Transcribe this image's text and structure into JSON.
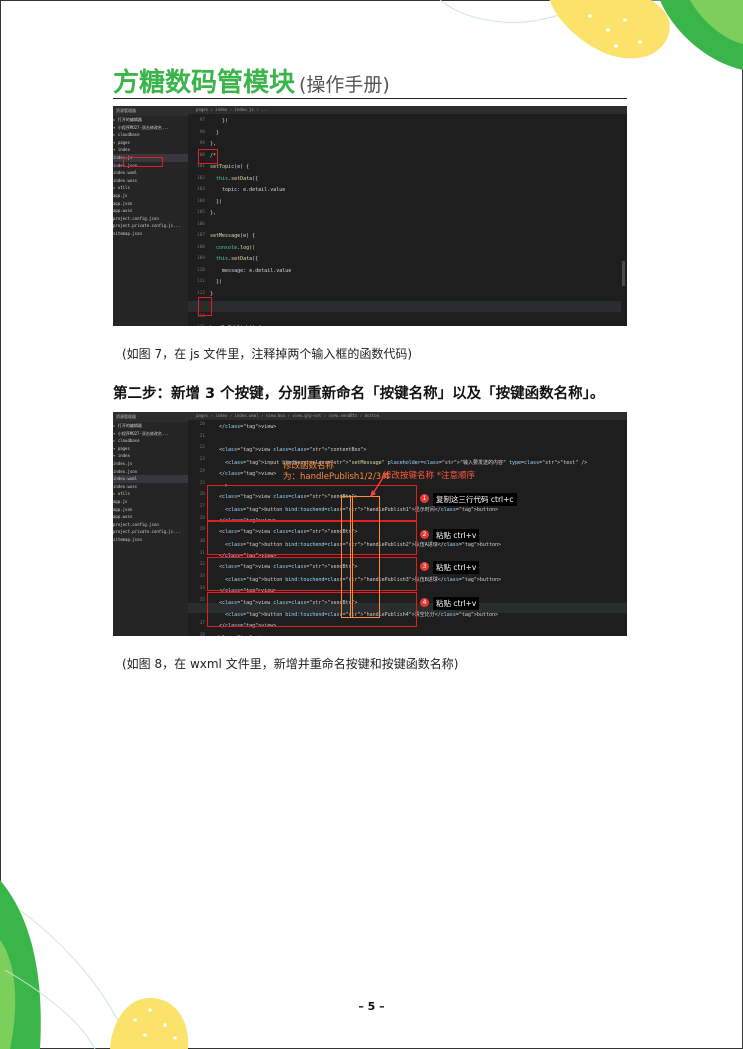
{
  "header": {
    "title": "方糖数码管模块",
    "subtitle": "(操作手册)"
  },
  "fig7": {
    "sidebar_title": "资源管理器",
    "sidebar_rows": [
      "▸ 打开的编辑器",
      "▾ 小程序MO27-双击修改名...",
      "  ▸ cloudbase",
      "  ▾ pages",
      "    ▾ index",
      "      index.js",
      "      index.json",
      "      index.wxml",
      "      index.wxss",
      "  ▸ utils",
      "    app.js",
      "    app.json",
      "    app.wxss",
      "    project.config.json",
      "    project.private.config.js...",
      "    sitemap.json"
    ],
    "tabs": "pages › index › index.js › ...",
    "line_numbers": [
      "97",
      "98",
      "99",
      "100",
      "101",
      "102",
      "103",
      "104",
      "105",
      "106",
      "107",
      "108",
      "109",
      "110",
      "111",
      "112",
      "113",
      "114",
      "115"
    ],
    "code": [
      "    })",
      "  }",
      "},",
      "/*",
      "setTopic(e) {",
      "  this.setData({",
      "    topic: e.detail.value",
      "  })",
      "},",
      "",
      "setMessage(e) {",
      "  console.log()",
      "  this.setData({",
      "    message: e.detail.value",
      "  })",
      "}",
      "*/",
      "",
      "handlePublish() {"
    ],
    "caption": "(如图 7，在 js 文件里，注释掉两个输入框的函数代码)"
  },
  "step2": "第二步：新增 3 个按键，分别重新命名「按键名称」以及「按键函数名称」。",
  "fig8": {
    "sidebar_title": "资源管理器",
    "sidebar_rows": [
      "▸ 打开的编辑器",
      "▾ 小程序MO27-双击修改名...",
      "  ▸ cloudbase",
      "  ▾ pages",
      "    ▾ index",
      "      index.js",
      "      index.json",
      "      index.wxml",
      "      index.wxss",
      "  ▸ utils",
      "    app.js",
      "    app.json",
      "    app.wxss",
      "    project.config.json",
      "    project.private.config.js...",
      "    sitemap.json"
    ],
    "tabs": "pages › index › index.wxml › view.box › view.grp-set › view.sendBtn › button",
    "line_numbers": [
      "20",
      "21",
      "22",
      "23",
      "24",
      "25",
      "26",
      "27",
      "28",
      "29",
      "30",
      "31",
      "32",
      "33",
      "34",
      "35",
      "36",
      "37",
      "38",
      "39"
    ],
    "code": [
      "  </view>",
      "",
      "  <view class=\"contentBox\">",
      "    <input bindinput=\"setMessage\" placeholder=\"输入要发送的内容\" type=\"text\" />",
      "  </view>",
      "  -->",
      "  <view class=\"sendBtn\">",
      "    <button bind:touchend=\"handlePublish1\">显示时间</button>",
      "  </view>",
      "  <view class=\"sendBtn\">",
      "    <button bind:touchend=\"handlePublish2\">队伍A进球</button>",
      "  </view>",
      "  <view class=\"sendBtn\">",
      "    <button bind:touchend=\"handlePublish3\">队伍B进球</button>",
      "  </view>",
      "  <view class=\"sendBtn\">",
      "    <button bind:touchend=\"handlePublish4\">清空比分</button>",
      "  </view>",
      "</view>"
    ],
    "ann_fn": "修改函数名称",
    "ann_fn2": "为：handlePublish1/2/3/4",
    "ann_key": "修改按键名称 *注意顺序",
    "labels": [
      "复制这三行代码 ctrl+c",
      "粘贴 ctrl+v",
      "粘贴 ctrl+v",
      "粘贴 ctrl+v"
    ],
    "badges": [
      "1",
      "2",
      "3",
      "4"
    ],
    "caption": "(如图 8，在 wxml 文件里，新增并重命名按键和按键函数名称)"
  },
  "footer": {
    "page": "– 5 –"
  },
  "colors": {
    "accent_green": "#39b54a",
    "highlight_red": "#e02020",
    "annotation_orange": "#ff8a3c",
    "editor_bg": "#1e1e1e"
  }
}
